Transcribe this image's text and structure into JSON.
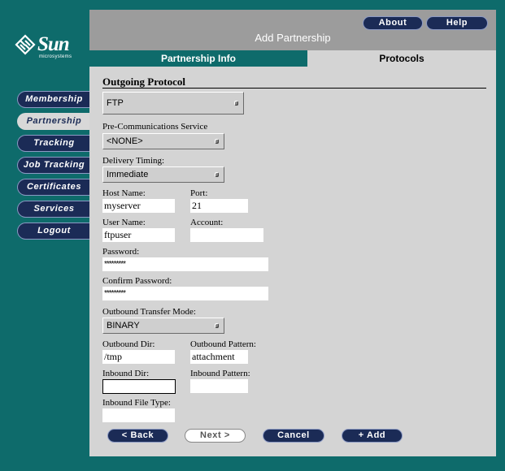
{
  "logo": {
    "word": "Sun",
    "sub": "microsystems"
  },
  "nav": [
    "Membership",
    "Partnership",
    "Tracking",
    "Job Tracking",
    "Certificates",
    "Services",
    "Logout"
  ],
  "header": {
    "about": "About",
    "help": "Help",
    "title": "Add Partnership"
  },
  "tabs": {
    "info": "Partnership Info",
    "protocols": "Protocols"
  },
  "section": {
    "title": "Outgoing Protocol"
  },
  "protocol": {
    "value": "FTP"
  },
  "precomm": {
    "label": "Pre-Communications Service",
    "value": "<NONE>"
  },
  "timing": {
    "label": "Delivery Timing:",
    "value": "Immediate"
  },
  "host": {
    "label": "Host Name:",
    "value": "myserver"
  },
  "port": {
    "label": "Port:",
    "value": "21"
  },
  "user": {
    "label": "User Name:",
    "value": "ftpuser"
  },
  "account": {
    "label": "Account:",
    "value": ""
  },
  "password": {
    "label": "Password:",
    "value": "*********"
  },
  "confirm": {
    "label": "Confirm Password:",
    "value": "*********"
  },
  "mode": {
    "label": "Outbound Transfer Mode:",
    "value": "BINARY"
  },
  "outdir": {
    "label": "Outbound Dir:",
    "value": "/tmp"
  },
  "outpattern": {
    "label": "Outbound Pattern:",
    "value": "attachment"
  },
  "indir": {
    "label": "Inbound Dir:",
    "value": ""
  },
  "inpattern": {
    "label": "Inbound Pattern:",
    "value": ""
  },
  "infiletype": {
    "label": "Inbound File Type:",
    "value": ""
  },
  "buttons": {
    "back": "< Back",
    "next": "Next >",
    "cancel": "Cancel",
    "add": "+ Add"
  },
  "colors": {
    "background": "#0e6b6b",
    "button": "#1b2b56",
    "panel": "#d4d4d4",
    "header": "#9c9c9c"
  }
}
